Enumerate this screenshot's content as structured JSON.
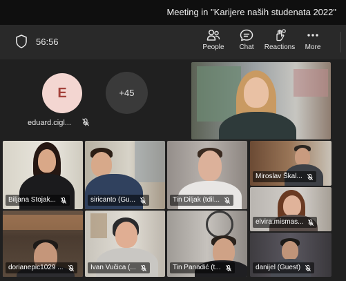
{
  "window": {
    "title": "Meeting in \"Karijere naših studenata 2022\""
  },
  "toolbar": {
    "timer": "56:56",
    "buttons": [
      {
        "label": "People",
        "icon": "people-icon"
      },
      {
        "label": "Chat",
        "icon": "chat-icon",
        "active": true
      },
      {
        "label": "Reactions",
        "icon": "reactions-icon"
      },
      {
        "label": "More",
        "icon": "more-icon"
      }
    ]
  },
  "stage": {
    "avatar": {
      "initial": "E",
      "name": "eduard.cigl...",
      "muted": true
    },
    "overflow_count": "+45"
  },
  "participants": [
    {
      "name": "Biljana Stojak...",
      "muted": true
    },
    {
      "name": "siricanto (Gu...",
      "muted": true
    },
    {
      "name": "Tin Diljak (tdil...",
      "muted": true
    },
    {
      "name": "Miroslav Škal...",
      "muted": true
    },
    {
      "name": "elvira.mismas...",
      "muted": true
    },
    {
      "name": "dorianepic1029 ...",
      "muted": true,
      "selected": true
    },
    {
      "name": "Ivan Vučica (...",
      "muted": true
    },
    {
      "name": "Tin Panadić (t...",
      "muted": true
    },
    {
      "name": "danijel (Guest)",
      "muted": true
    }
  ],
  "colors": {
    "accent": "#7f85f5",
    "background": "#1f1f1f",
    "toolbar": "#292929"
  }
}
